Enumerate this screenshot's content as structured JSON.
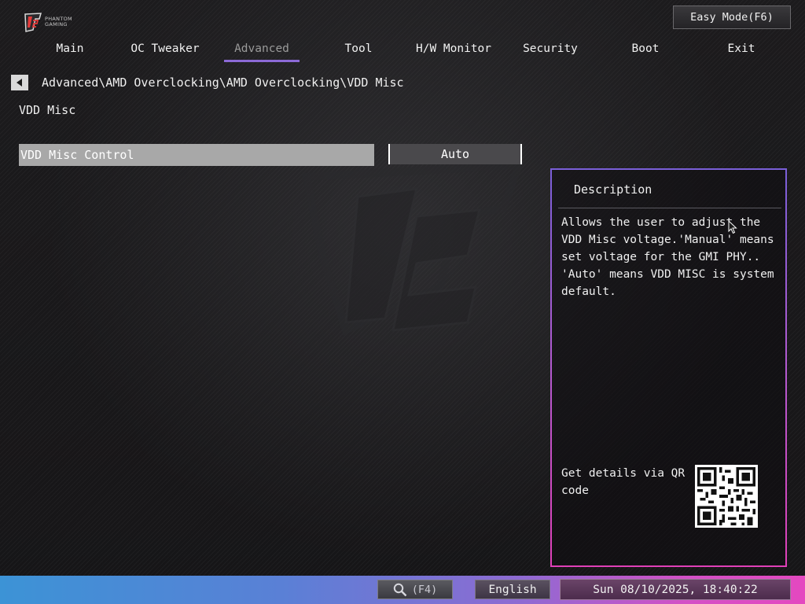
{
  "logo": {
    "brand_lines": [
      "PHANTOM",
      "GAMING"
    ]
  },
  "header": {
    "easy_mode_label": "Easy Mode(F6)"
  },
  "nav": {
    "tabs": [
      {
        "label": "Main"
      },
      {
        "label": "OC Tweaker"
      },
      {
        "label": "Advanced",
        "active": true
      },
      {
        "label": "Tool"
      },
      {
        "label": "H/W Monitor"
      },
      {
        "label": "Security"
      },
      {
        "label": "Boot"
      },
      {
        "label": "Exit"
      }
    ],
    "active_color": "#8c6ad6"
  },
  "breadcrumb": {
    "path": "Advanced\\AMD Overclocking\\AMD Overclocking\\VDD Misc"
  },
  "page": {
    "title": "VDD Misc",
    "options": [
      {
        "label": "VDD Misc Control",
        "value": "Auto",
        "selected": true
      }
    ]
  },
  "description": {
    "title": "Description",
    "text": "Allows the user to adjust the VDD Misc voltage.'Manual' means set voltage for the GMI PHY.. 'Auto' means VDD MISC is system default.",
    "qr_label": "Get details via QR code"
  },
  "footer": {
    "search_icon": "search-icon",
    "search_key": "(F4)",
    "language": "English",
    "datetime": "Sun 08/10/2025, 18:40:22"
  },
  "colors": {
    "accent_purple": "#8c6ad6",
    "panel_border_top": "#7a5fd8",
    "panel_border_bottom": "#e040b8",
    "footer_left": "#3c93d6",
    "footer_right": "#e448c0",
    "selected_row": "#a8a8a8"
  }
}
